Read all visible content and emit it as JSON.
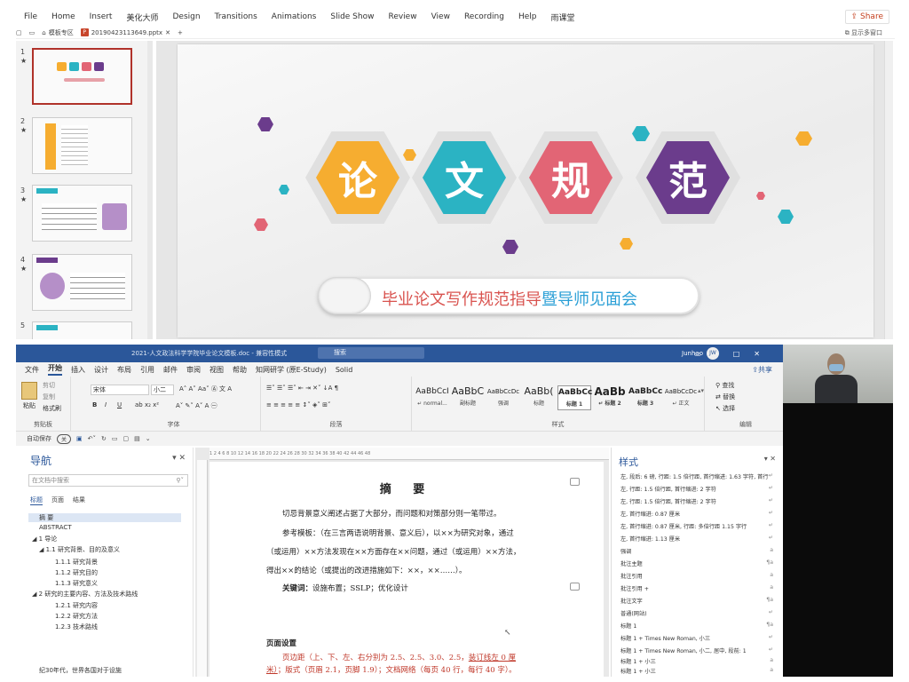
{
  "ppt": {
    "menu": [
      "File",
      "Home",
      "Insert",
      "美化大师",
      "Design",
      "Transitions",
      "Animations",
      "Slide Show",
      "Review",
      "View",
      "Recording",
      "Help",
      "雨课堂"
    ],
    "share_label": "Share",
    "tabs": {
      "home_tab": "模板专区",
      "file_tab": "20190423113649.pptx"
    },
    "multi_window_label": "显示多窗口",
    "slide_numbers": [
      "1",
      "2",
      "3",
      "4",
      "5"
    ],
    "slide": {
      "chars": [
        "论",
        "文",
        "规",
        "范"
      ],
      "subtitle_red": "毕业论文写作规范指导",
      "subtitle_blue": "暨导师见面会"
    },
    "colors": {
      "hex1": "#f6ad30",
      "hex2": "#2bb3c3",
      "hex3": "#e26575",
      "hex4": "#6b3c8c"
    }
  },
  "word": {
    "title": "2021-人文政法科学学院毕业论文模板.doc  -  兼容性模式",
    "search_placeholder": "搜索",
    "user": "Junhao",
    "avatar": "JW",
    "menu": [
      "文件",
      "开始",
      "插入",
      "设计",
      "布局",
      "引用",
      "邮件",
      "审阅",
      "视图",
      "帮助",
      "知网研学 (原E-Study)",
      "Solid"
    ],
    "share_label": "共享",
    "ribbon": {
      "paste": "粘贴",
      "cut": "剪切",
      "copy": "复制",
      "format_painter": "格式刷",
      "clipboard_group": "剪贴板",
      "font_name": "宋体",
      "font_size": "小二",
      "font_group": "字体",
      "paragraph_group": "段落",
      "styles_group": "样式",
      "edit_group": "编辑",
      "find": "查找",
      "replace": "替换",
      "select": "选择",
      "styles": [
        {
          "sample": "AaBbCcI",
          "label": "↵ normal..."
        },
        {
          "sample": "AaBbC",
          "label": "副标题"
        },
        {
          "sample": "AaBbCcDc",
          "label": "强调"
        },
        {
          "sample": "AaBb(",
          "label": "标题"
        },
        {
          "sample": "AaBbCc",
          "label": "标题 1"
        },
        {
          "sample": "AaBb",
          "label": "↵ 标题 2"
        },
        {
          "sample": "AaBbCc",
          "label": "标题 3"
        },
        {
          "sample": "AaBbCcDc",
          "label": "↵ 正文"
        }
      ]
    },
    "autosave_label": "自动保存",
    "autosave_state": "关",
    "nav": {
      "title": "导航",
      "search_placeholder": "在文档中搜索",
      "tabs": [
        "标题",
        "页面",
        "结果"
      ],
      "items": [
        "摘 要",
        "ABSTRACT",
        "◢ 1 导论",
        "◢ 1.1 研究背景、目的及意义",
        "1.1.1 研究背景",
        "1.1.2 研究目的",
        "1.1.3 研究意义",
        "◢ 2 研究的主要内容、方法及技术路线",
        "1.2.1 研究内容",
        "1.2.2 研究方法",
        "1.2.3 技术路线"
      ],
      "footer_text": "纪30年代，世界各国对于设施"
    },
    "ruler_text": "1  2  4  6  8  10  12  14  16  18  20  22  24  26  28  30  32  34  36  38  40  42  44  46  48",
    "doc": {
      "heading": "摘  要",
      "p1": "切忌背景意义阐述占据了大部分，而问题和对策部分则一笔带过。",
      "p2": "参考模板：（在三言两语说明背景、意义后），以××为研究对象，通过",
      "p3": "（或运用）××方法发现在××方面存在××问题，通过（或运用）××方法，",
      "p4": "得出××的结论（或提出的改进措施如下：××，××……）。",
      "kw_label": "关键词：",
      "kw": "设施布置；SSLP；优化设计",
      "sec": "页面设置",
      "p5a": "页边距（上、下、左、右分别为 2.5、2.5、3.0、2.5，",
      "p5b": "装订线左 0 厘",
      "p6a": "米）",
      "p6b": "；版式（页眉 2.1，页脚 1.9）；文档网络（每页 40 行，每行 40 字）。"
    },
    "styles_pane": {
      "title": "样式",
      "rows": [
        {
          "name": "左, 段后: 6 磅, 行距: 1.5 倍行距, 首行缩进: 1.63 字符, 首行",
          "mark": "↵"
        },
        {
          "name": "左, 行距: 1.5 倍行距, 首行缩进: 2 字符",
          "mark": "↵"
        },
        {
          "name": "左, 行距: 1.5 倍行距, 首行缩进: 2 字符",
          "mark": "↵"
        },
        {
          "name": "左, 首行缩进: 0.87 厘米",
          "mark": "↵"
        },
        {
          "name": "左, 首行缩进: 0.87 厘米, 行距: 多倍行距 1.15 字行",
          "mark": "↵"
        },
        {
          "name": "左, 首行缩进: 1.13 厘米",
          "mark": "↵"
        },
        {
          "name": "强调",
          "mark": "a"
        },
        {
          "name": "批注主题",
          "mark": "¶a"
        },
        {
          "name": "批注引用",
          "mark": "a"
        },
        {
          "name": "批注引用 +",
          "mark": "a"
        },
        {
          "name": "批注文字",
          "mark": "¶a"
        },
        {
          "name": "普通(网站)",
          "mark": "↵"
        },
        {
          "name": "标题 1",
          "mark": "¶a"
        },
        {
          "name": "标题 1 + Times New Roman, 小三",
          "mark": "↵"
        },
        {
          "name": "标题 1 + Times New Roman, 小二, 居中, 段前: 1",
          "mark": "↵"
        },
        {
          "name": "标题 1 + 小三",
          "mark": "a"
        },
        {
          "name": "标题 1 + 小三",
          "mark": "a"
        }
      ]
    }
  }
}
